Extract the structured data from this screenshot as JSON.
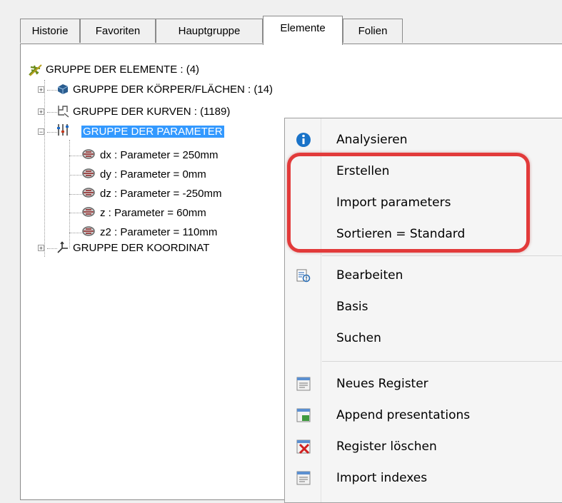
{
  "tabs": [
    "Historie",
    "Favoriten",
    "Hauptgruppe",
    "Elemente",
    "Folien"
  ],
  "active_tab": "Elemente",
  "tree": {
    "root": "GRUPPE DER ELEMENTE :  (4)",
    "groups": [
      "GRUPPE DER KÖRPER/FLÄCHEN :  (14)",
      "GRUPPE DER KURVEN :  (1189)",
      "GRUPPE DER PARAMETER",
      "GRUPPE DER KOORDINAT"
    ],
    "parameters": [
      "dx : Parameter = 250mm",
      "dy : Parameter = 0mm",
      "dz : Parameter = -250mm",
      "z : Parameter = 60mm",
      "z2 : Parameter = 110mm"
    ]
  },
  "context_menu": {
    "items": [
      {
        "label": "Analysieren",
        "icon": "info-icon"
      },
      {
        "label": "Erstellen",
        "icon": ""
      },
      {
        "label": "Import parameters",
        "icon": ""
      },
      {
        "label": "Sortieren = Standard",
        "icon": ""
      },
      {
        "label": "Bearbeiten",
        "icon": "edit-icon"
      },
      {
        "label": "Basis",
        "icon": ""
      },
      {
        "label": "Suchen",
        "icon": ""
      },
      {
        "label": "Neues Register",
        "icon": "new-register-icon"
      },
      {
        "label": "Append presentations",
        "icon": "append-presentations-icon"
      },
      {
        "label": "Register löschen",
        "icon": "delete-register-icon"
      },
      {
        "label": "Import indexes",
        "icon": "import-indexes-icon"
      }
    ]
  },
  "colors": {
    "selection": "#3399ff",
    "highlight_border": "#e23a3a"
  }
}
